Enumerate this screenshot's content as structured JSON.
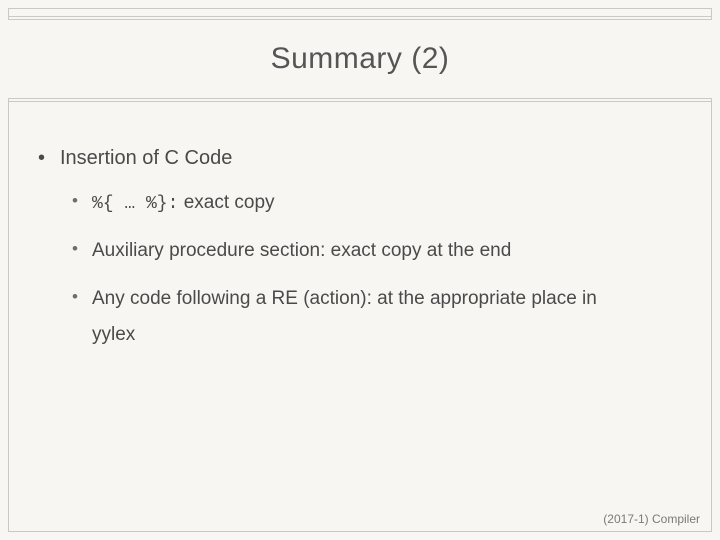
{
  "title": "Summary (2)",
  "bullets": {
    "main": "Insertion of C Code",
    "sub1_code": "%{ … %}:",
    "sub1_rest": "  exact copy",
    "sub2": "Auxiliary procedure section: exact copy at the end",
    "sub3": "Any code following a RE (action): at the appropriate place in",
    "yylex": "yylex"
  },
  "footer": "(2017-1) Compiler"
}
